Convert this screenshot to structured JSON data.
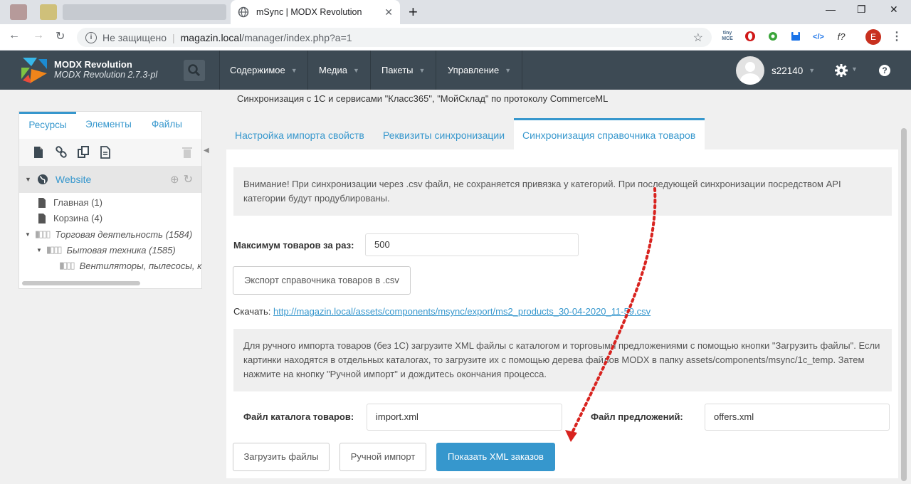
{
  "browser": {
    "tab_title": "mSync | MODX Revolution",
    "tab_close": "✕",
    "new_tab": "+",
    "window_controls": [
      "—",
      "❐",
      "✕"
    ],
    "security_label": "Не защищено",
    "url_host": "magazin.local",
    "url_path": "/manager/index.php?a=1",
    "profile_initial": "E",
    "extensions": [
      "tinymce-icon",
      "opera-icon",
      "puzzle-icon",
      "save-icon",
      "code-icon",
      "fx-icon"
    ],
    "ext_tiny": "tiny MCE",
    "ext_f": "f?"
  },
  "header": {
    "brand_title": "MODX Revolution",
    "brand_version": "MODX Revolution 2.7.3-pl",
    "nav": [
      {
        "label": "Содержимое"
      },
      {
        "label": "Медиа"
      },
      {
        "label": "Пакеты"
      },
      {
        "label": "Управление"
      }
    ],
    "username": "s22140",
    "colors": {
      "header_bg": "#3d4a54",
      "accent": "#3697cd"
    }
  },
  "sidebar": {
    "tabs": [
      "Ресурсы",
      "Элементы",
      "Файлы"
    ],
    "root": "Website",
    "items": [
      {
        "label": "Главная (1)"
      },
      {
        "label": "Корзина (4)"
      },
      {
        "label": "Торговая деятельность (1584)"
      },
      {
        "label": "Бытовая техника (1585)"
      },
      {
        "label": "Вентиляторы, пылесосы, кс"
      }
    ]
  },
  "main": {
    "description": "Синхронизация с 1С и сервисами \"Класс365\", \"МойСклад\" по протоколу CommerceML",
    "tabs": [
      {
        "label": "Настройка импорта свойств"
      },
      {
        "label": "Реквизиты синхронизации"
      },
      {
        "label": "Синхронизация справочника товаров"
      }
    ],
    "note1": "Внимание! При синхронизации через .csv файл, не сохраняется привязка у категорий. При последующей синхронизации посредством API категории будут продублированы.",
    "max_label": "Максимум товаров за раз:",
    "max_value": "500",
    "export_button": "Экспорт справочника товаров в .csv",
    "download_label": "Скачать:",
    "download_link": "http://magazin.local/assets/components/msync/export/ms2_products_30-04-2020_11-59.csv",
    "note2": "Для ручного импорта товаров (без 1С) загрузите XML файлы с каталогом и торговыми предложениями с помощью кнопки \"Загрузить файлы\". Если картинки находятся в отдельных каталогах, то загрузите их с помощью дерева файлов MODX в папку assets/components/msync/1c_temp. Затем нажмите на кнопку \"Ручной импорт\" и дождитесь окончания процесса.",
    "catalog_label": "Файл каталога товаров:",
    "catalog_value": "import.xml",
    "offers_label": "Файл предложений:",
    "offers_value": "offers.xml",
    "upload_button": "Загрузить файлы",
    "manual_button": "Ручной импорт",
    "orders_button": "Показать XML заказов"
  }
}
